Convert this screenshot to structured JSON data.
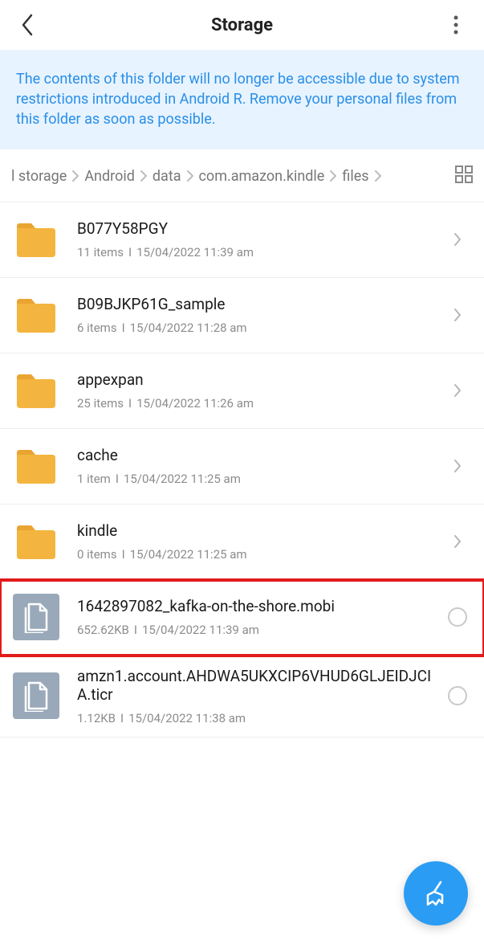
{
  "header": {
    "title": "Storage"
  },
  "banner": {
    "text": "The contents of this folder will no longer be accessible due to system restrictions introduced in Android R. Remove your personal files from this folder as soon as possible."
  },
  "breadcrumbs": [
    "l storage",
    "Android",
    "data",
    "com.amazon.kindle",
    "files"
  ],
  "items": [
    {
      "type": "folder",
      "name": "B077Y58PGY",
      "meta1": "11 items",
      "meta2": "15/04/2022 11:39 am",
      "tail": "chevron",
      "highlight": false
    },
    {
      "type": "folder",
      "name": "B09BJKP61G_sample",
      "meta1": "6 items",
      "meta2": "15/04/2022 11:28 am",
      "tail": "chevron",
      "highlight": false
    },
    {
      "type": "folder",
      "name": "appexpan",
      "meta1": "25 items",
      "meta2": "15/04/2022 11:26 am",
      "tail": "chevron",
      "highlight": false
    },
    {
      "type": "folder",
      "name": "cache",
      "meta1": "1 item",
      "meta2": "15/04/2022 11:25 am",
      "tail": "chevron",
      "highlight": false
    },
    {
      "type": "folder",
      "name": "kindle",
      "meta1": "0 items",
      "meta2": "15/04/2022 11:25 am",
      "tail": "chevron",
      "highlight": false
    },
    {
      "type": "file",
      "name": "1642897082_kafka-on-the-shore.mobi",
      "meta1": "652.62KB",
      "meta2": "15/04/2022 11:39 am",
      "tail": "radio",
      "highlight": true
    },
    {
      "type": "file",
      "name": "amzn1.account.AHDWA5UKXCIP6VHUD6GLJEIDJCIA.ticr",
      "meta1": "1.12KB",
      "meta2": "15/04/2022 11:38 am",
      "tail": "radio",
      "highlight": false
    }
  ]
}
